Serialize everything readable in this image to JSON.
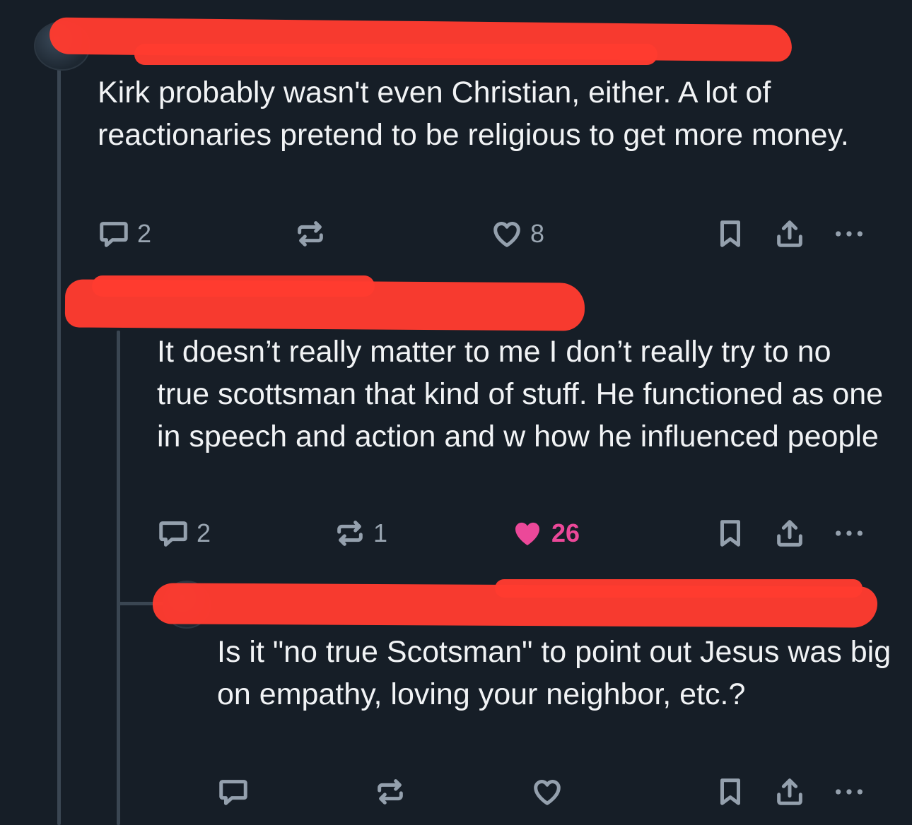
{
  "colors": {
    "background": "#161e27",
    "text": "#f1f3f5",
    "icon": "#94a0ad",
    "like_active": "#ec4899",
    "redaction": "#ff3b30",
    "thread_line": "#3a4652"
  },
  "posts": [
    {
      "text": "Kirk probably wasn't even Christian, either. A lot of reactionaries pretend to be religious to get more money.",
      "replies": "2",
      "reposts": "",
      "likes": "8",
      "liked": false
    },
    {
      "text": "It doesn’t really matter to me I don’t really try to no true scottsman that kind of stuff. He functioned as one in speech and action and w how he influenced people",
      "replies": "2",
      "reposts": "1",
      "likes": "26",
      "liked": true
    },
    {
      "text": "Is it \"no true Scotsman\" to point out Jesus was big on empathy, loving your neighbor, etc.?",
      "replies": "",
      "reposts": "",
      "likes": "",
      "liked": false
    }
  ],
  "icons": {
    "reply": "speech-bubble-icon",
    "repost": "repost-arrows-icon",
    "like": "heart-icon",
    "bookmark": "bookmark-icon",
    "share": "share-upload-icon",
    "more": "ellipsis-icon"
  }
}
